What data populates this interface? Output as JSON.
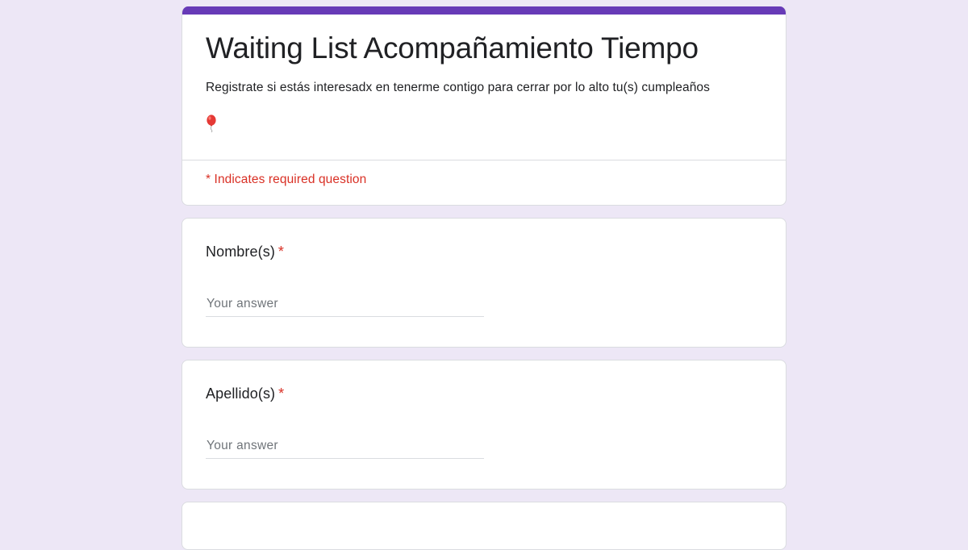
{
  "form": {
    "title": "Waiting List Acompañamiento Tiempo",
    "description": "Registrate si estás interesadx en tenerme contigo para cerrar por lo alto tu(s) cumpleaños",
    "description_icon": "balloon-icon",
    "required_note": "* Indicates required question"
  },
  "questions": [
    {
      "label": "Nombre(s)",
      "required_mark": "*",
      "placeholder": "Your answer"
    },
    {
      "label": "Apellido(s)",
      "required_mark": "*",
      "placeholder": "Your answer"
    }
  ],
  "colors": {
    "background": "#ede7f6",
    "accent": "#673ab7",
    "required": "#d93025",
    "card": "#ffffff",
    "divider": "#dadce0"
  }
}
